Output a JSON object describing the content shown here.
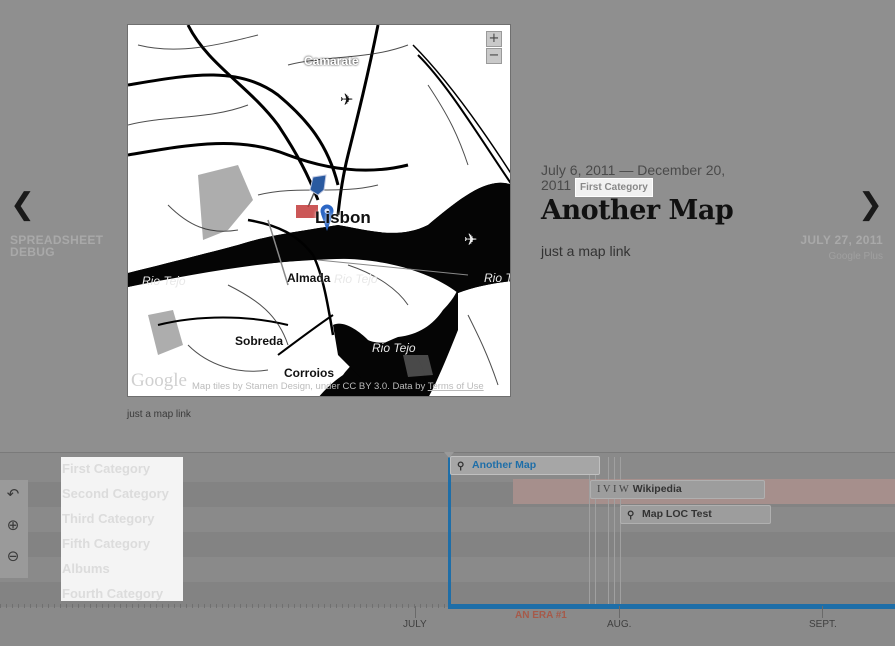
{
  "slider": {
    "prev": {
      "arrow": "❮",
      "title": "SPREADSHEET DEBUG"
    },
    "next": {
      "arrow": "❯",
      "title": "JULY 27, 2011",
      "subtitle": "Google Plus"
    },
    "map": {
      "zoom_in": "+",
      "zoom_out": "−",
      "google_logo": "Google",
      "attribution": "Map tiles by Stamen Design, under CC BY 3.0. Data by ",
      "terms_link": "Terms of Use",
      "labels": {
        "camarate": "Camarate",
        "lisbon": "Lisbon",
        "almada": "Almada",
        "rio_tejo_1": "Rio Tejo",
        "rio_tejo_2": "Rio Tejo",
        "rio_tejo_3": "Rio Tejo",
        "rio_tejo_4": "Rio Tejo",
        "sobreda": "Sobreda",
        "corroios": "Corroios"
      },
      "caption": "just a map link"
    },
    "slide": {
      "date": "July 6, 2011 — December 20, 2011",
      "category": "First Category",
      "headline": "Another Map",
      "text": "just a map link"
    }
  },
  "timeline": {
    "tools": {
      "back": "↶",
      "zoom_in": "⊕",
      "zoom_out": "⊖"
    },
    "categories": [
      "First Category",
      "Second Category",
      "Third Category",
      "Fifth Category",
      "Albums",
      "Fourth Category"
    ],
    "flags": {
      "another_map": "Another Map",
      "wikipedia": "Wikipedia",
      "map_loc": "Map LOC Test",
      "wiki_glyphs": "I V I W"
    },
    "era_label": "AN ERA #1",
    "months": {
      "july": "JULY",
      "aug": "AUG.",
      "sept": "SEPT."
    }
  },
  "colors": {
    "accent": "#1e6ea8",
    "era": "#a68f8c"
  }
}
